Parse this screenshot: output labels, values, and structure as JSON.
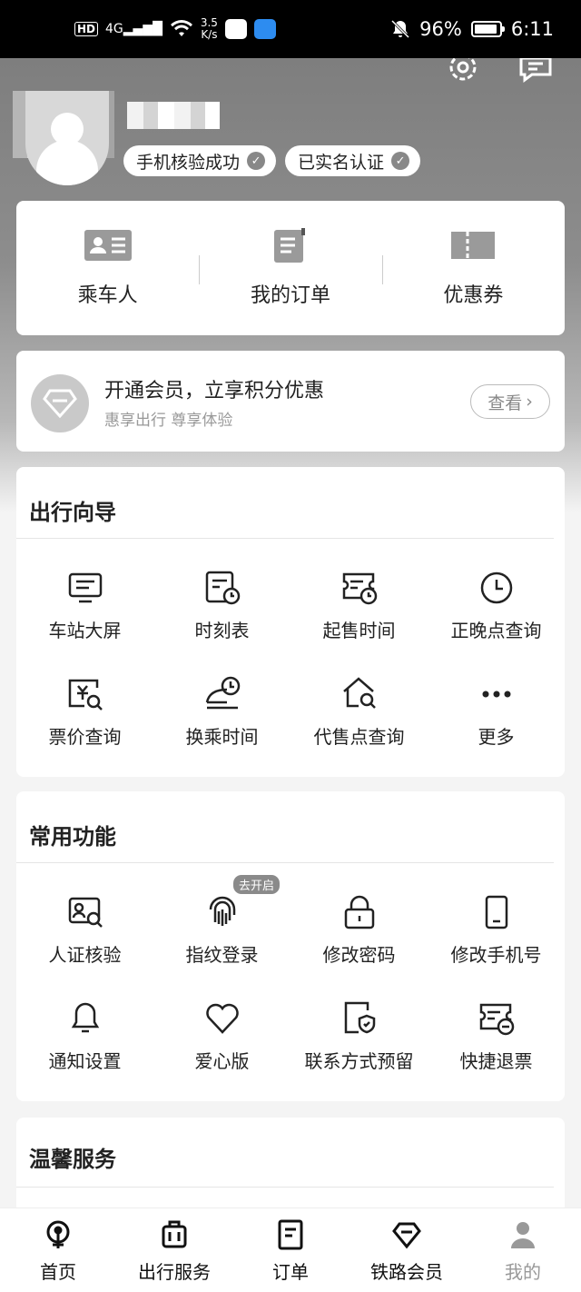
{
  "status_bar": {
    "hd": "HD",
    "signal": "4G",
    "speed_value": "3.5",
    "speed_unit": "K/s",
    "battery": "96%",
    "time": "6:11"
  },
  "profile": {
    "badges": [
      "手机核验成功",
      "已实名认证"
    ]
  },
  "quick_links": [
    "乘车人",
    "我的订单",
    "优惠券"
  ],
  "member": {
    "title": "开通会员，立享积分优惠",
    "subtitle": "惠享出行 尊享体验",
    "button": "查看"
  },
  "travel_guide": {
    "title": "出行向导",
    "items": [
      "车站大屏",
      "时刻表",
      "起售时间",
      "正晚点查询",
      "票价查询",
      "换乘时间",
      "代售点查询",
      "更多"
    ]
  },
  "common": {
    "title": "常用功能",
    "tag": "去开启",
    "items": [
      "人证核验",
      "指纹登录",
      "修改密码",
      "修改手机号",
      "通知设置",
      "爱心版",
      "联系方式预留",
      "快捷退票"
    ]
  },
  "warm": {
    "title": "温馨服务"
  },
  "tabs": [
    "首页",
    "出行服务",
    "订单",
    "铁路会员",
    "我的"
  ],
  "colors": {
    "active_tab": "#111111",
    "inactive_tab": "#999999",
    "hero_gray": "#8d8d8d"
  }
}
